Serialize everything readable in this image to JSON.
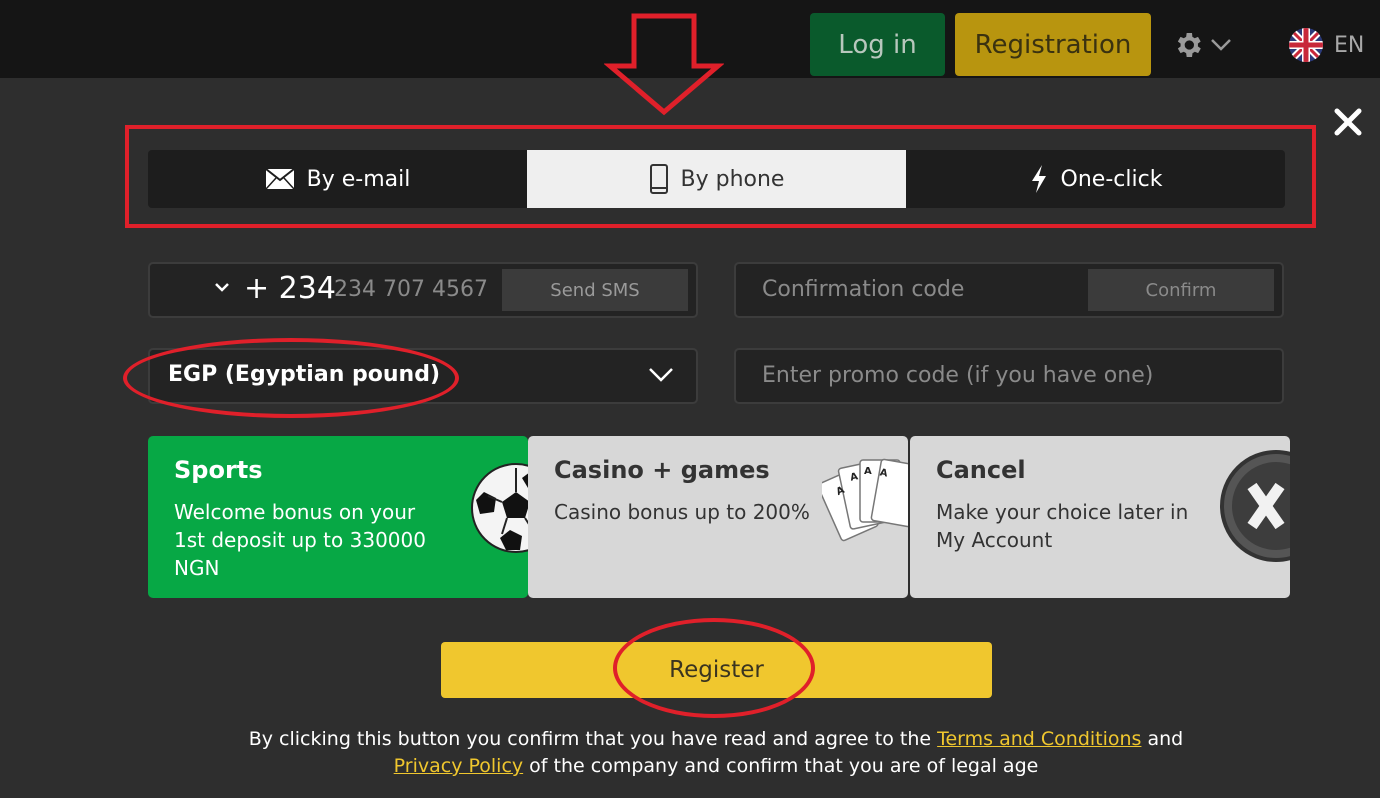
{
  "header": {
    "login_label": "Log in",
    "registration_label": "Registration",
    "settings_icon": "gear-icon",
    "language": "EN",
    "language_flag": "uk-flag-icon"
  },
  "tabs": [
    {
      "label": "By e-mail",
      "icon": "envelope-icon",
      "active": false
    },
    {
      "label": "By phone",
      "icon": "phone-icon",
      "active": true
    },
    {
      "label": "One-click",
      "icon": "lightning-icon",
      "active": false
    }
  ],
  "form": {
    "phone_prefix": "+ 234",
    "phone_placeholder": "234 707 4567",
    "send_sms_label": "Send SMS",
    "confirmation_placeholder": "Confirmation code",
    "confirm_label": "Confirm",
    "currency_value": "EGP (Egyptian pound)",
    "promo_placeholder": "Enter promo code (if you have one)"
  },
  "bonuses": [
    {
      "title": "Sports",
      "description": "Welcome bonus on your 1st deposit up to 330000 NGN",
      "color": "#07a845"
    },
    {
      "title": "Casino + games",
      "description": "Casino bonus up to 200%",
      "color": "#d7d7d7"
    },
    {
      "title": "Cancel",
      "description": "Make your choice later in My Account",
      "color": "#d7d7d7"
    }
  ],
  "register_label": "Register",
  "legal": {
    "text_1": "By clicking this button you confirm that you have read and agree to the ",
    "terms_link": "Terms and Conditions",
    "text_2": " and ",
    "privacy_link": "Privacy Policy",
    "text_3": " of the company and confirm that you are of legal age"
  },
  "colors": {
    "accent_yellow": "#f0c72e",
    "accent_green": "#07a845",
    "annotation_red": "#e0202a",
    "background": "#2e2e2e"
  }
}
